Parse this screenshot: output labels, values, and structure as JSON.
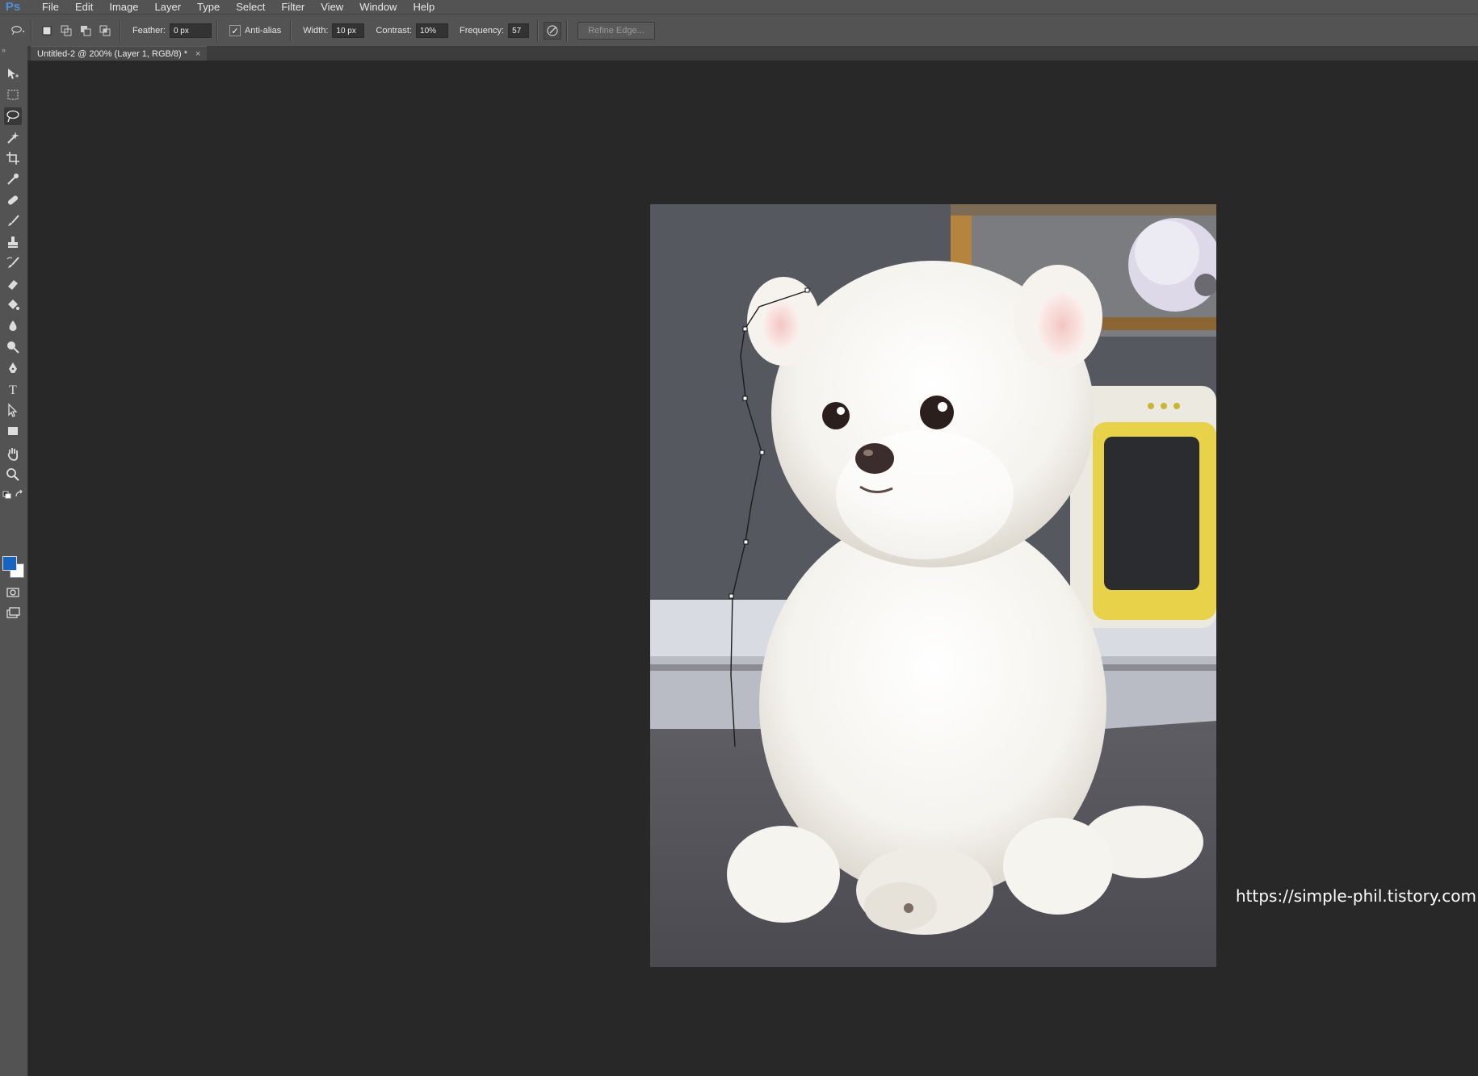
{
  "app": {
    "logo": "Ps"
  },
  "menu": [
    "File",
    "Edit",
    "Image",
    "Layer",
    "Type",
    "Select",
    "Filter",
    "View",
    "Window",
    "Help"
  ],
  "options": {
    "feather_label": "Feather:",
    "feather_value": "0 px",
    "antialias_label": "Anti-alias",
    "antialias_checked": true,
    "width_label": "Width:",
    "width_value": "10 px",
    "contrast_label": "Contrast:",
    "contrast_value": "10%",
    "frequency_label": "Frequency:",
    "frequency_value": "57",
    "refine_edge_label": "Refine Edge..."
  },
  "document": {
    "tab_title": "Untitled-2 @ 200% (Layer 1, RGB/8) *",
    "close_glyph": "×"
  },
  "tools": [
    "move-tool-icon",
    "marquee-tool-icon",
    "magnetic-lasso-tool-icon",
    "magic-wand-tool-icon",
    "crop-tool-icon",
    "eyedropper-tool-icon",
    "healing-brush-tool-icon",
    "brush-tool-icon",
    "clone-stamp-tool-icon",
    "history-brush-tool-icon",
    "eraser-tool-icon",
    "paint-bucket-tool-icon",
    "blur-tool-icon",
    "dodge-tool-icon",
    "pen-tool-icon",
    "type-tool-icon",
    "path-selection-tool-icon",
    "rectangle-tool-icon",
    "hand-tool-icon",
    "zoom-tool-icon"
  ],
  "colors": {
    "foreground": "#1565c0",
    "background": "#ffffff",
    "ui_panel": "#535353",
    "canvas_bg": "#282828"
  },
  "watermark": "https://simple-phil.tistory.com"
}
